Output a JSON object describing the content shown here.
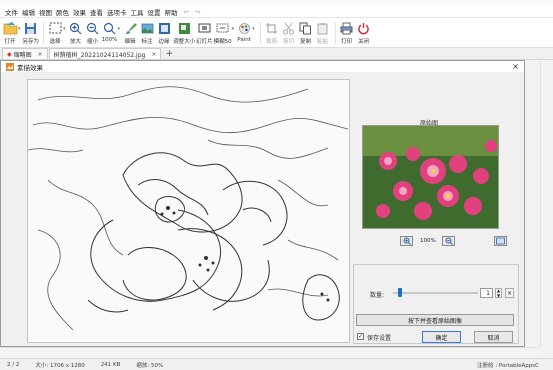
{
  "menu": {
    "items": [
      "文件",
      "编辑",
      "视图",
      "颜色",
      "效果",
      "查看",
      "选项卡",
      "工具",
      "设置",
      "帮助"
    ],
    "back_glyph": "↩",
    "forward_glyph": "↪"
  },
  "toolbar": {
    "open": "打开",
    "save_as": "另存为",
    "select": "选择",
    "zoom_in": "放大",
    "zoom_out": "缩小",
    "zoom_100": "100%",
    "edit": "编辑",
    "tag": "标注",
    "border": "边缘",
    "resize": "调整大小",
    "slideshow": "幻灯片",
    "blur": "模糊50",
    "paint": "Paint",
    "crop": "裁剪",
    "cut": "剪切",
    "copy": "复制",
    "paste": "粘贴",
    "print": "打印",
    "close": "关闭"
  },
  "tabs": [
    {
      "label": "缩略图"
    },
    {
      "label": "树荫植树_20221024114052.jpg"
    }
  ],
  "tab_add": "+",
  "dialog": {
    "title": "素描效果",
    "preview_label": "原始图",
    "zoom_value": "100%",
    "slider_label": "数量:",
    "slider_value": "1",
    "slider_fraction": 0.06,
    "apply_button": "按下并查看原始图像",
    "checkbox_label": "保存设置",
    "checkbox_checked": true,
    "ok": "确定",
    "cancel": "取消",
    "close": "×"
  },
  "status": {
    "index": "2 / 2",
    "size": "大小: 1706 x 1280",
    "filesize": "241 KB",
    "zoom": "缩放: 50%",
    "registration": "注册给 : PortableAppsC"
  },
  "colors": {
    "accent": "#1e6fd0",
    "preview_bg": "#fafafa",
    "sketch_line": "#444444"
  }
}
